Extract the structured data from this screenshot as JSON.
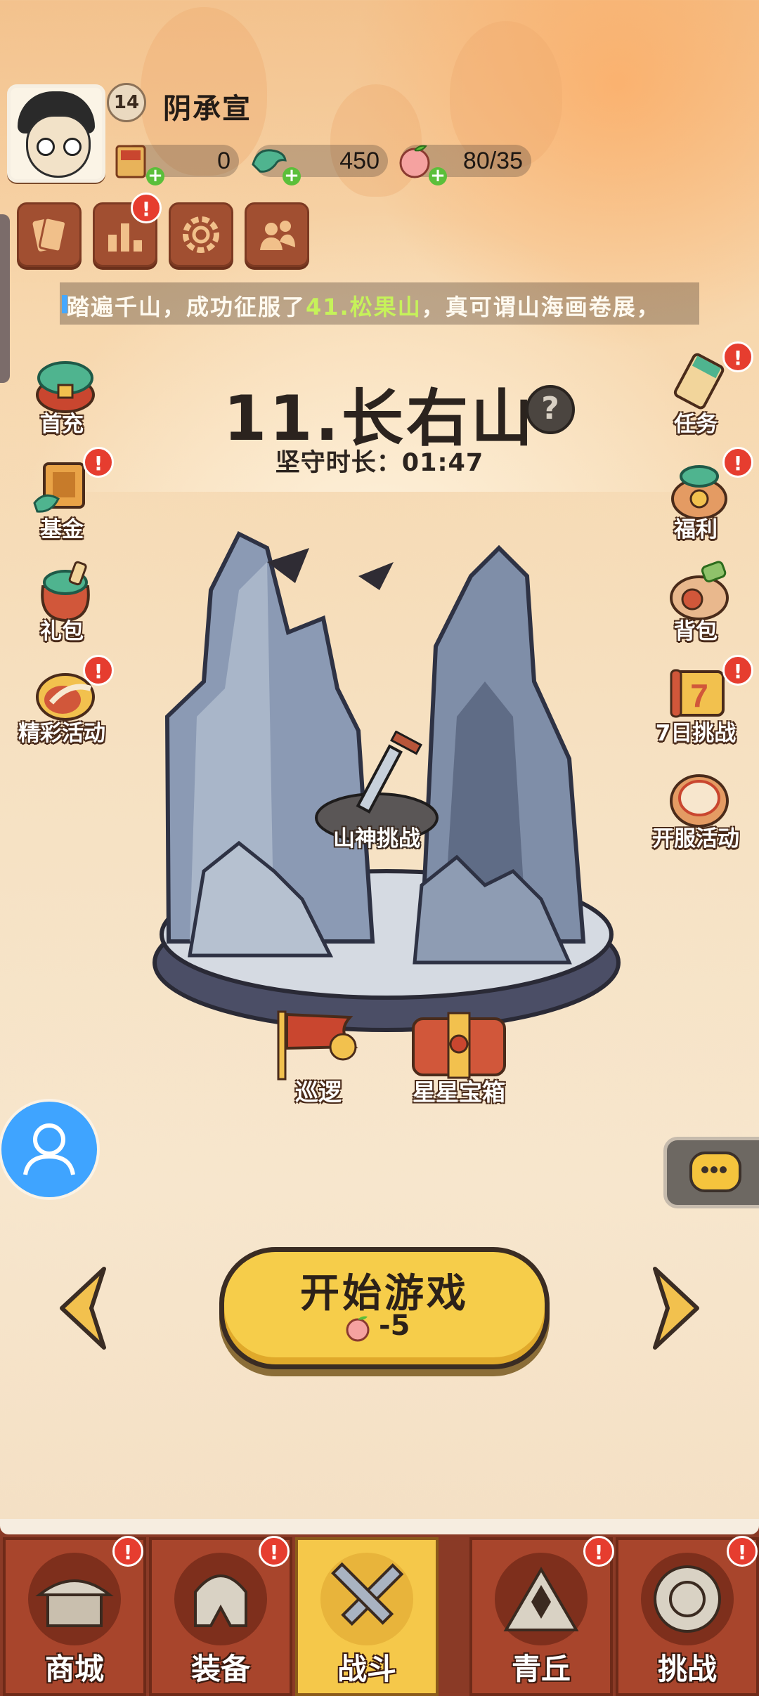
{
  "player": {
    "level": "14",
    "name": "阴承宣"
  },
  "resources": [
    {
      "icon": "scroll-ticket-icon",
      "value": "0"
    },
    {
      "icon": "jade-dragon-icon",
      "value": "450"
    },
    {
      "icon": "peach-stamina-icon",
      "value": "80/35"
    }
  ],
  "toolbar": [
    {
      "icon": "tickets-icon",
      "badge": ""
    },
    {
      "icon": "ranking-icon",
      "badge": "!"
    },
    {
      "icon": "settings-gear-icon",
      "badge": ""
    },
    {
      "icon": "friends-icon",
      "badge": ""
    }
  ],
  "marquee": {
    "before": "踏遍千山，成功征服了",
    "highlight": "41.松果山",
    "after": "，真可谓山海画卷展，"
  },
  "left_menu": [
    {
      "label": "首充",
      "badge": ""
    },
    {
      "label": "基金",
      "badge": "!"
    },
    {
      "label": "礼包",
      "badge": ""
    },
    {
      "label": "精彩活动",
      "badge": "!"
    }
  ],
  "right_menu": [
    {
      "label": "任务",
      "badge": "!"
    },
    {
      "label": "福利",
      "badge": "!"
    },
    {
      "label": "背包",
      "badge": ""
    },
    {
      "label": "7日挑战",
      "badge": "!"
    },
    {
      "label": "开服活动",
      "badge": ""
    }
  ],
  "stage": {
    "title": "11.长右山",
    "help": "?",
    "hold_time_label": "坚守时长：01:47",
    "boss_label": "山神挑战"
  },
  "map_items": [
    {
      "label": "巡逻"
    },
    {
      "label": "星星宝箱"
    }
  ],
  "start": {
    "label": "开始游戏",
    "cost": "-5"
  },
  "bottom_nav": [
    {
      "label": "商城",
      "badge": "!",
      "active": false
    },
    {
      "label": "装备",
      "badge": "!",
      "active": false
    },
    {
      "label": "战斗",
      "badge": "",
      "active": true
    },
    {
      "label": "青丘",
      "badge": "!",
      "active": false
    },
    {
      "label": "挑战",
      "badge": "!",
      "active": false
    }
  ],
  "colors": {
    "accent_yellow": "#f6cd4a",
    "nav_red": "#a8452c",
    "badge_red": "#e63d2f",
    "marquee_highlight": "#c6f25a"
  }
}
